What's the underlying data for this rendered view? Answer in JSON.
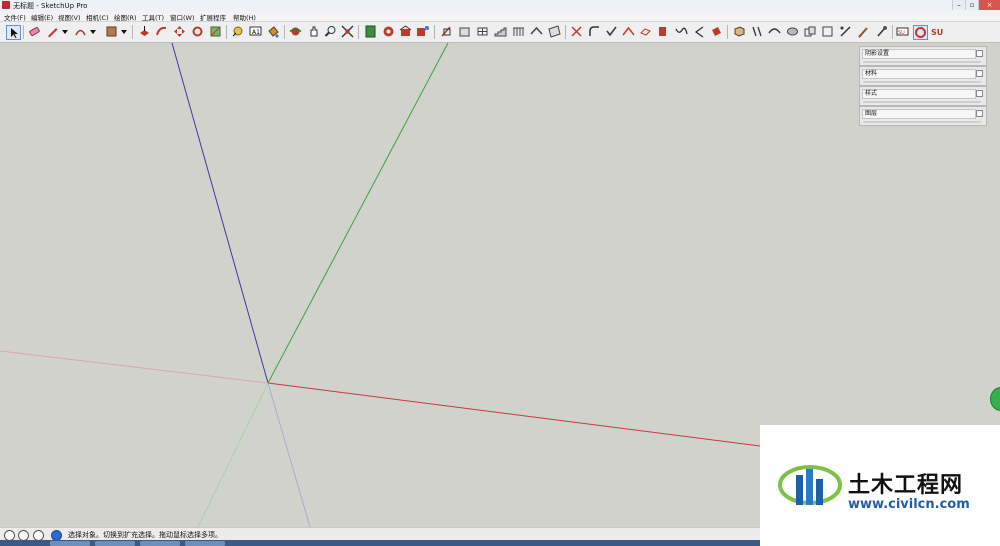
{
  "window": {
    "title": "无标题 - SketchUp Pro"
  },
  "menu": [
    {
      "label": "文件(F)"
    },
    {
      "label": "编辑(E)"
    },
    {
      "label": "视图(V)"
    },
    {
      "label": "相机(C)"
    },
    {
      "label": "绘图(R)"
    },
    {
      "label": "工具(T)"
    },
    {
      "label": "窗口(W)"
    },
    {
      "label": "扩展程序"
    },
    {
      "label": "帮助(H)"
    }
  ],
  "toolbar_icons": [
    "select-icon",
    "eraser-icon",
    "pencil-icon",
    "dropdown-icon",
    "arc-icon",
    "dropdown-icon",
    "rectangle-icon",
    "dropdown-icon",
    "push-pull-icon",
    "follow-me-icon",
    "move-icon",
    "rotate-icon",
    "scale-icon",
    "tape-measure-icon",
    "text-icon",
    "paint-bucket-icon",
    "orbit-icon",
    "pan-icon",
    "zoom-icon",
    "zoom-extents-icon",
    "scenes-icon",
    "components-icon",
    "warehouse-icon",
    "share-icon"
  ],
  "tray_panels": [
    {
      "title": "阴影设置"
    },
    {
      "title": "材料"
    },
    {
      "title": "样式"
    },
    {
      "title": "图层"
    }
  ],
  "status": {
    "text": "选择对象。切换到扩充选择。拖动鼠标选择多项。"
  },
  "watermark": {
    "title": "土木工程网",
    "url": "www.civilcn.com"
  },
  "colors": {
    "axis_red": "#c23b3b",
    "axis_green": "#3aa33a",
    "axis_blue": "#3a3aa8",
    "viewport_bg": "#d2d2cd"
  }
}
